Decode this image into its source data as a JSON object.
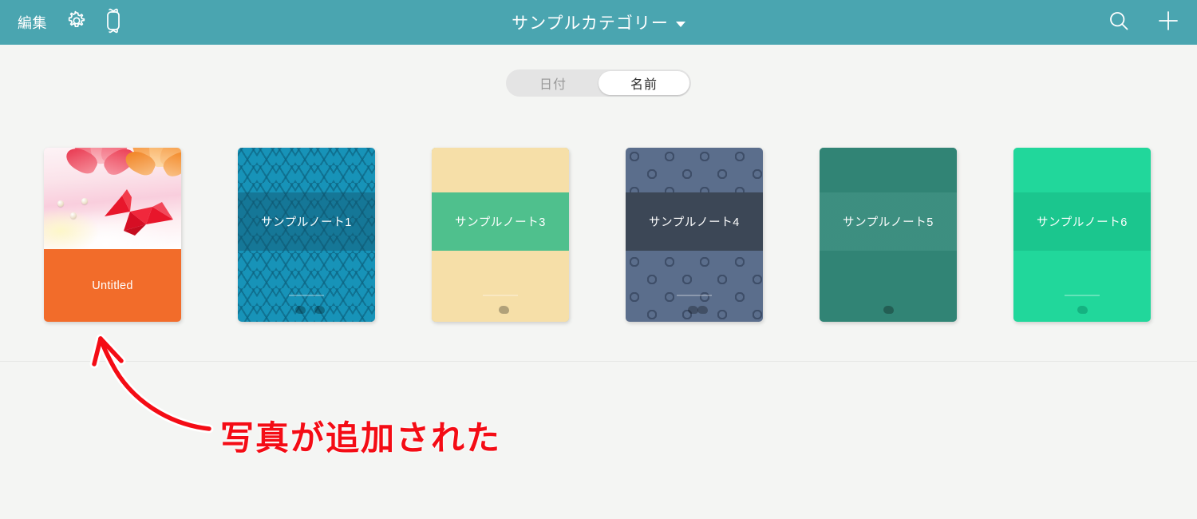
{
  "header": {
    "background_color": "#4aa5b0",
    "edit_label": "編集",
    "settings_icon": "gear-icon",
    "device_icon": "smartwatch-icon",
    "title": "サンプルカテゴリー",
    "title_caret": "chevron-down-icon",
    "search_icon": "search-icon",
    "add_icon": "plus-icon"
  },
  "sort_control": {
    "options": [
      {
        "label": "日付",
        "selected": false
      },
      {
        "label": "名前",
        "selected": true
      }
    ]
  },
  "notebooks": [
    {
      "title": "Untitled",
      "cover_type": "photo",
      "cover_description": "origami-crane-photo",
      "band_color": "#f26c2a",
      "text_color": "#ffffff",
      "has_sync_marks": false
    },
    {
      "title": "サンプルノート1",
      "cover_type": "pattern",
      "cover_description": "blue-zigzag-chevron",
      "base_color": "#1793b8",
      "pattern_color": "#157c9c",
      "band_color": "#2f7f9e",
      "text_color": "#ffffff",
      "has_sync_marks": true
    },
    {
      "title": "サンプルノート3",
      "cover_type": "pattern",
      "cover_description": "teal-cream-abstract-dashes",
      "base_color": "#2ea0ac",
      "pattern_color": "#f6dfa8",
      "band_color": "#4fc08d",
      "text_color": "#ffffff",
      "has_sync_marks": true
    },
    {
      "title": "サンプルノート4",
      "cover_type": "pattern",
      "cover_description": "slate-blue-rings",
      "base_color": "#5b6e8c",
      "pattern_color": "#46587a",
      "band_color": "#3c4756",
      "text_color": "#ffffff",
      "has_sync_marks": true
    },
    {
      "title": "サンプルノート5",
      "cover_type": "pattern",
      "cover_description": "sage-green-plus-crosses",
      "base_color": "#9ccfc4",
      "pattern_color": "#3f9c8b",
      "band_color": "#72b5a7",
      "text_color": "#ffffff",
      "has_sync_marks": true
    },
    {
      "title": "サンプルノート6",
      "cover_type": "solid",
      "cover_description": "solid-emerald",
      "base_color": "#21d79b",
      "pattern_color": "#21d79b",
      "band_color": "#1cbd89",
      "text_color": "#ffffff",
      "has_sync_marks": true
    }
  ],
  "annotation": {
    "text": "写真が追加された",
    "color": "#f40c15",
    "arrow": "curved-arrow-pointing-up-left",
    "target": "notebook-card-0"
  },
  "page": {
    "background_color": "#f4f5f3",
    "divider_color": "#e6e7e4"
  }
}
